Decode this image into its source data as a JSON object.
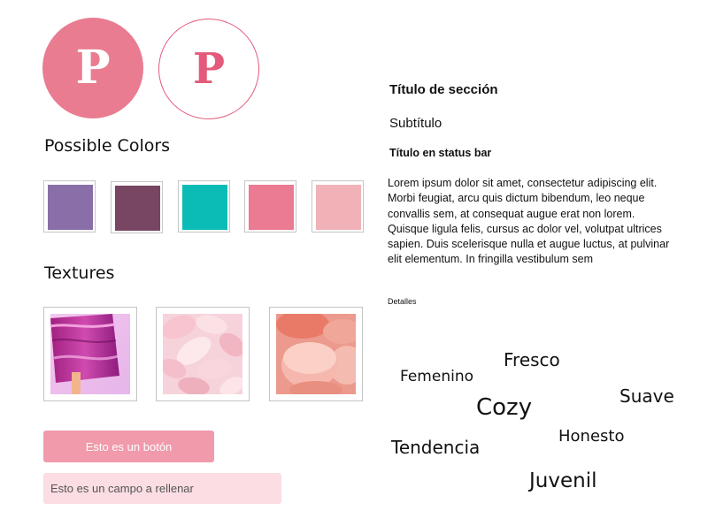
{
  "logos": [
    {
      "letter": "P",
      "style": "filled",
      "color": "#e97c91"
    },
    {
      "letter": "P",
      "style": "outline",
      "color": "#e45a7a"
    }
  ],
  "colors_section": {
    "heading": "Possible Colors",
    "swatches": [
      "#8a6ea7",
      "#784663",
      "#0bbcb6",
      "#eb7a93",
      "#f0b2b7"
    ]
  },
  "textures_section": {
    "heading": "Textures",
    "items": [
      "purple-glitter-texture",
      "rose-petals-texture",
      "macarons-texture"
    ]
  },
  "controls": {
    "button_label": "Esto es un botón",
    "field_placeholder": "Esto es un campo a rellenar"
  },
  "typography": {
    "section_title": "Título de sección",
    "subtitle": "Subtítulo",
    "statusbar_title": "Título en status bar",
    "body": "Lorem ipsum dolor sit amet, consectetur adipiscing elit. Morbi feugiat, arcu quis dictum bibendum, leo neque convallis sem, at consequat augue erat non lorem. Quisque ligula felis, cursus ac dolor vel, volutpat ultrices sapien. Duis scelerisque nulla et augue luctus, at pulvinar elit elementum. In fringilla vestibulum sem",
    "details": "Detalles"
  },
  "word_cloud": {
    "fresco": "Fresco",
    "femenino": "Femenino",
    "suave": "Suave",
    "cozy": "Cozy",
    "honesto": "Honesto",
    "tendencia": "Tendencia",
    "juvenil": "Juvenil"
  }
}
